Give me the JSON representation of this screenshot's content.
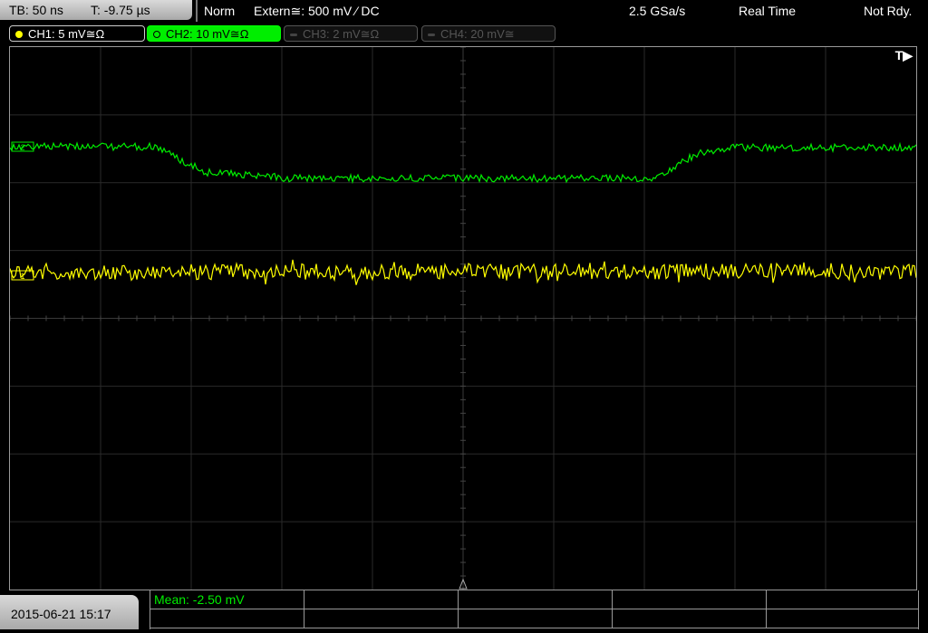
{
  "header": {
    "timebase": "TB: 50 ns",
    "trigger_time": "T: -9.75 µs",
    "trigger_mode": "Norm",
    "trigger_source": "Extern≅: 500 mV ⁄ DC",
    "sample_rate": "2.5 GSa/s",
    "acq_mode": "Real Time",
    "ready_status": "Not Rdy."
  },
  "channels": [
    {
      "label": "CH1: 5 mV≅Ω",
      "color": "#ffff00",
      "active": true
    },
    {
      "label": "CH2: 10 mV≅Ω",
      "color": "#00ee00",
      "active": true,
      "selected": true
    },
    {
      "label": "CH3: 2 mV≅Ω",
      "color": "#555555",
      "active": false
    },
    {
      "label": "CH4: 20 mV≅",
      "color": "#555555",
      "active": false
    }
  ],
  "screen": {
    "trigger_marker": "T▶",
    "ch1_marker": "1",
    "ch2_marker": "2"
  },
  "footer": {
    "datetime": "2015-06-21 15:17",
    "measurement": "Mean: -2.50 mV"
  }
}
